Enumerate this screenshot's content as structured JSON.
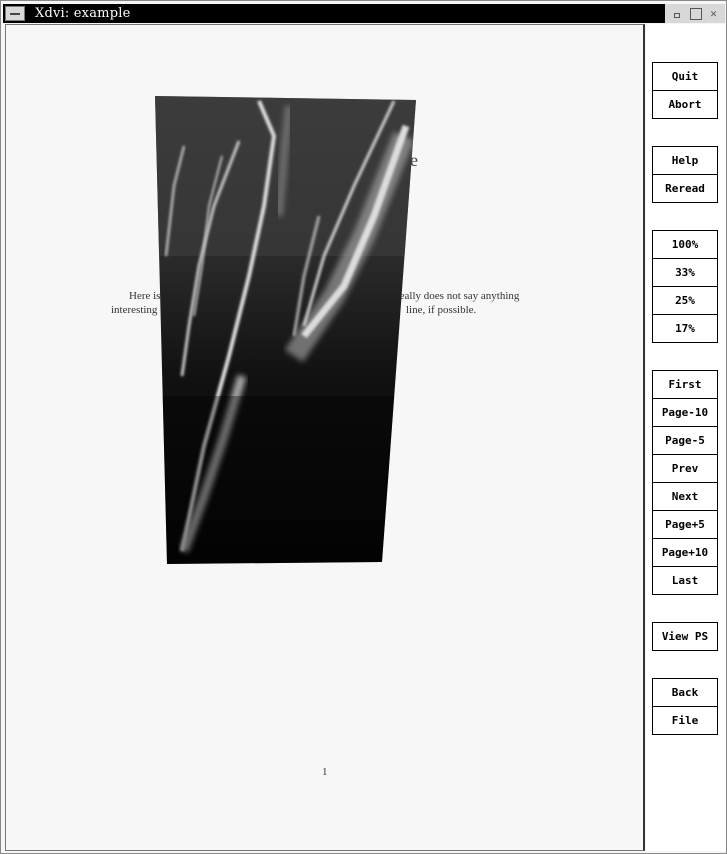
{
  "window": {
    "title": "Xdvi:  example"
  },
  "document": {
    "heading_fragment": "e",
    "line1_left": "Here is",
    "line1_right": "really does not say anything",
    "line2_left": "interesting",
    "line2_right": "line, if possible.",
    "page_number": "1"
  },
  "sidebar": {
    "quit": "Quit",
    "abort": "Abort",
    "help": "Help",
    "reread": "Reread",
    "zoom_100": "100%",
    "zoom_33": "33%",
    "zoom_25": "25%",
    "zoom_17": "17%",
    "first": "First",
    "page_minus_10": "Page-10",
    "page_minus_5": "Page-5",
    "prev": "Prev",
    "next": "Next",
    "page_plus_5": "Page+5",
    "page_plus_10": "Page+10",
    "last": "Last",
    "view_ps": "View PS",
    "back": "Back",
    "file": "File"
  },
  "icons": {
    "window_menu": "window-menu-icon",
    "minimize": "minimize-icon",
    "maximize": "maximize-icon",
    "close": "close-icon"
  }
}
